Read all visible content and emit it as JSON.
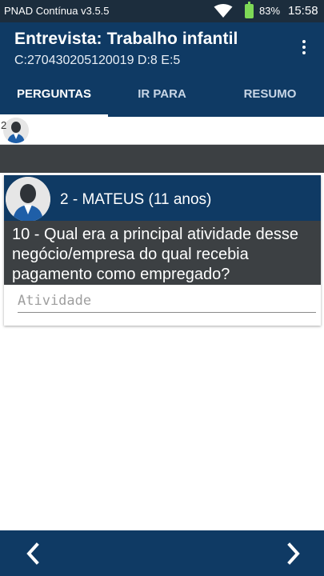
{
  "status_bar": {
    "app_version": "PNAD Contínua v3.5.5",
    "battery_percent": "83%",
    "time": "15:58",
    "icons": [
      "wifi-icon",
      "battery-icon"
    ]
  },
  "app_bar": {
    "title": "Entrevista: Trabalho infantil",
    "subtitle": "C:270430205120019 D:8 E:5",
    "menu_icon": "more-vert-icon"
  },
  "tabs": [
    {
      "label": "PERGUNTAS",
      "active": true
    },
    {
      "label": "IR PARA",
      "active": false
    },
    {
      "label": "RESUMO",
      "active": false
    }
  ],
  "strip": {
    "number": "2"
  },
  "card": {
    "person": "2 - MATEUS (11 anos)",
    "question": "10 - Qual era a principal atividade desse negócio/empresa do qual recebia pagamento como empregado?",
    "input_placeholder": "Atividade",
    "input_value": ""
  },
  "bottom_nav": {
    "prev_icon": "chevron-left-icon",
    "next_icon": "chevron-right-icon"
  },
  "colors": {
    "primary": "#0f3a64",
    "status_bar": "#1c2d3d",
    "question_bg": "#3c4043",
    "battery": "#7ed957"
  }
}
